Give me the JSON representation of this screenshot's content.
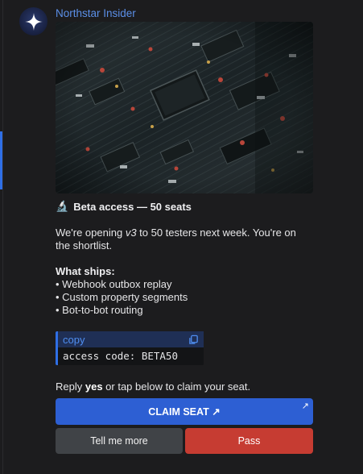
{
  "message": {
    "sender": "Northstar Insider",
    "title_emoji": "🔬",
    "title": "Beta access — 50 seats",
    "intro_before": "We're opening ",
    "intro_version": "v3",
    "intro_after": " to 50 testers next week. You're on the shortlist.",
    "ships_heading": "What ships:",
    "ships_items": [
      "Webhook outbox replay",
      "Custom property segments",
      "Bot-to-bot routing"
    ],
    "code_label": "copy",
    "code_text": "access code: BETA50",
    "reply_before": "Reply ",
    "reply_keyword": "yes",
    "reply_after": " or tap below to claim your seat."
  },
  "buttons": {
    "claim": "CLAIM SEAT ↗",
    "more": "Tell me more",
    "pass": "Pass"
  },
  "icons": {
    "avatar": "sparkle-star-icon",
    "copy": "copy-icon",
    "external": "external-link-icon"
  },
  "colors": {
    "background": "#1c1c1e",
    "sender": "#5b8fe8",
    "accent": "#2f6fe6",
    "claim_button": "#2d5fd3",
    "more_button": "#404347",
    "pass_button": "#c63c32"
  }
}
